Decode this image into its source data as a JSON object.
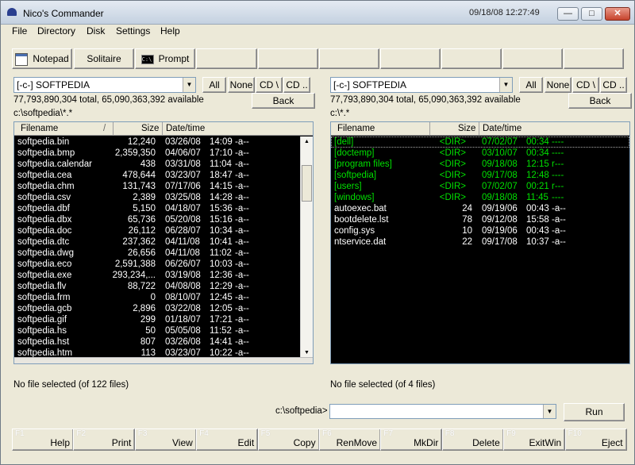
{
  "window": {
    "title": "Nico's Commander",
    "clock": "09/18/08   12:27:49",
    "min": "—",
    "max": "□",
    "close": "✕"
  },
  "menu": [
    "File",
    "Directory",
    "Disk",
    "Settings",
    "Help"
  ],
  "toolbar": {
    "notepad": "Notepad",
    "solitaire": "Solitaire",
    "prompt": "Prompt",
    "prompt_icon_text": "C:\\"
  },
  "left": {
    "drive": "[-c-] SOFTPEDIA",
    "all": "All",
    "none": "None",
    "cd_root": "CD \\",
    "cd_up": "CD ..",
    "space": "77,793,890,304 total, 65,090,363,392 available",
    "back": "Back",
    "path": "c:\\softpedia\\*.*",
    "headers": {
      "name": "Filename",
      "size": "Size",
      "date": "Date/time",
      "sort": "/"
    },
    "rows": [
      {
        "name": "softpedia.bin",
        "size": "12,240",
        "date": "03/26/08",
        "time": "14:09",
        "attr": "-a--"
      },
      {
        "name": "softpedia.bmp",
        "size": "2,359,350",
        "date": "04/06/07",
        "time": "17:10",
        "attr": "-a--"
      },
      {
        "name": "softpedia.calendar",
        "size": "438",
        "date": "03/31/08",
        "time": "11:04",
        "attr": "-a--"
      },
      {
        "name": "softpedia.cea",
        "size": "478,644",
        "date": "03/23/07",
        "time": "18:47",
        "attr": "-a--"
      },
      {
        "name": "softpedia.chm",
        "size": "131,743",
        "date": "07/17/06",
        "time": "14:15",
        "attr": "-a--"
      },
      {
        "name": "softpedia.csv",
        "size": "2,389",
        "date": "03/25/08",
        "time": "14:28",
        "attr": "-a--"
      },
      {
        "name": "softpedia.dbf",
        "size": "5,150",
        "date": "04/18/07",
        "time": "15:36",
        "attr": "-a--"
      },
      {
        "name": "softpedia.dbx",
        "size": "65,736",
        "date": "05/20/08",
        "time": "15:16",
        "attr": "-a--"
      },
      {
        "name": "softpedia.doc",
        "size": "26,112",
        "date": "06/28/07",
        "time": "10:34",
        "attr": "-a--"
      },
      {
        "name": "softpedia.dtc",
        "size": "237,362",
        "date": "04/11/08",
        "time": "10:41",
        "attr": "-a--"
      },
      {
        "name": "softpedia.dwg",
        "size": "26,656",
        "date": "04/11/08",
        "time": "11:02",
        "attr": "-a--"
      },
      {
        "name": "softpedia.eco",
        "size": "2,591,388",
        "date": "06/26/07",
        "time": "10:03",
        "attr": "-a--"
      },
      {
        "name": "softpedia.exe",
        "size": "293,234,...",
        "date": "03/19/08",
        "time": "12:36",
        "attr": "-a--"
      },
      {
        "name": "softpedia.flv",
        "size": "88,722",
        "date": "04/08/08",
        "time": "12:29",
        "attr": "-a--"
      },
      {
        "name": "softpedia.frm",
        "size": "0",
        "date": "08/10/07",
        "time": "12:45",
        "attr": "-a--"
      },
      {
        "name": "softpedia.gcb",
        "size": "2,896",
        "date": "03/22/08",
        "time": "12:05",
        "attr": "-a--"
      },
      {
        "name": "softpedia.gif",
        "size": "299",
        "date": "01/18/07",
        "time": "17:21",
        "attr": "-a--"
      },
      {
        "name": "softpedia.hs",
        "size": "50",
        "date": "05/05/08",
        "time": "11:52",
        "attr": "-a--"
      },
      {
        "name": "softpedia.hst",
        "size": "807",
        "date": "03/26/08",
        "time": "14:41",
        "attr": "-a--"
      },
      {
        "name": "softpedia.htm",
        "size": "113",
        "date": "03/23/07",
        "time": "10:22",
        "attr": "-a--"
      }
    ],
    "status": "No file selected (of 122 files)"
  },
  "right": {
    "drive": "[-c-] SOFTPEDIA",
    "all": "All",
    "none": "None",
    "cd_root": "CD \\",
    "cd_up": "CD ..",
    "space": "77,793,890,304 total, 65,090,363,392 available",
    "back": "Back",
    "path": "c:\\*.*",
    "headers": {
      "name": "Filename",
      "size": "Size",
      "date": "Date/time",
      "sort": "/"
    },
    "rows": [
      {
        "name": "[dell]",
        "size": "<DIR>",
        "date": "07/02/07",
        "time": "00:34",
        "attr": "----",
        "dir": true
      },
      {
        "name": "[doctemp]",
        "size": "<DIR>",
        "date": "03/10/07",
        "time": "00:34",
        "attr": "----",
        "dir": true
      },
      {
        "name": "[program files]",
        "size": "<DIR>",
        "date": "09/18/08",
        "time": "12:15",
        "attr": "r---",
        "dir": true
      },
      {
        "name": "[softpedia]",
        "size": "<DIR>",
        "date": "09/17/08",
        "time": "12:48",
        "attr": "----",
        "dir": true
      },
      {
        "name": "[users]",
        "size": "<DIR>",
        "date": "07/02/07",
        "time": "00:21",
        "attr": "r---",
        "dir": true
      },
      {
        "name": "[windows]",
        "size": "<DIR>",
        "date": "09/18/08",
        "time": "11:45",
        "attr": "----",
        "dir": true
      },
      {
        "name": "autoexec.bat",
        "size": "24",
        "date": "09/19/06",
        "time": "00:43",
        "attr": "-a--"
      },
      {
        "name": "bootdelete.lst",
        "size": "78",
        "date": "09/12/08",
        "time": "15:58",
        "attr": "-a--"
      },
      {
        "name": "config.sys",
        "size": "10",
        "date": "09/19/06",
        "time": "00:43",
        "attr": "-a--"
      },
      {
        "name": "ntservice.dat",
        "size": "22",
        "date": "09/17/08",
        "time": "10:37",
        "attr": "-a--"
      }
    ],
    "status": "No file selected (of 4 files)"
  },
  "command": {
    "label": "c:\\softpedia>",
    "value": "",
    "run": "Run"
  },
  "fkeys": [
    {
      "num": "F1",
      "label": "Help"
    },
    {
      "num": "F2",
      "label": "Print"
    },
    {
      "num": "F3",
      "label": "View"
    },
    {
      "num": "F4",
      "label": "Edit"
    },
    {
      "num": "F5",
      "label": "Copy"
    },
    {
      "num": "F6",
      "label": "RenMove"
    },
    {
      "num": "F7",
      "label": "MkDir"
    },
    {
      "num": "F8",
      "label": "Delete"
    },
    {
      "num": "F9",
      "label": "ExitWin"
    },
    {
      "num": "F10",
      "label": "Eject"
    }
  ],
  "colors": {
    "list_bg": "#000000",
    "file_text": "#ffffff",
    "dir_text": "#00e000",
    "window_bg": "#ece9d8"
  }
}
